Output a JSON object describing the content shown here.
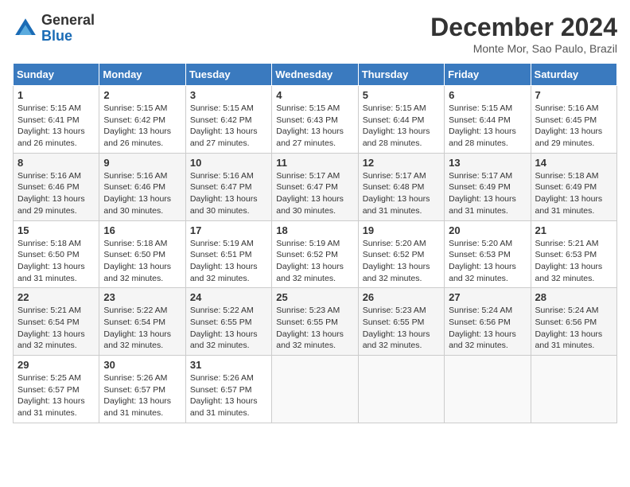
{
  "header": {
    "logo_line1": "General",
    "logo_line2": "Blue",
    "month": "December 2024",
    "location": "Monte Mor, Sao Paulo, Brazil"
  },
  "weekdays": [
    "Sunday",
    "Monday",
    "Tuesday",
    "Wednesday",
    "Thursday",
    "Friday",
    "Saturday"
  ],
  "weeks": [
    [
      {
        "day": "1",
        "rise": "5:15 AM",
        "set": "6:41 PM",
        "daylight": "13 hours and 26 minutes."
      },
      {
        "day": "2",
        "rise": "5:15 AM",
        "set": "6:42 PM",
        "daylight": "13 hours and 26 minutes."
      },
      {
        "day": "3",
        "rise": "5:15 AM",
        "set": "6:42 PM",
        "daylight": "13 hours and 27 minutes."
      },
      {
        "day": "4",
        "rise": "5:15 AM",
        "set": "6:43 PM",
        "daylight": "13 hours and 27 minutes."
      },
      {
        "day": "5",
        "rise": "5:15 AM",
        "set": "6:44 PM",
        "daylight": "13 hours and 28 minutes."
      },
      {
        "day": "6",
        "rise": "5:15 AM",
        "set": "6:44 PM",
        "daylight": "13 hours and 28 minutes."
      },
      {
        "day": "7",
        "rise": "5:16 AM",
        "set": "6:45 PM",
        "daylight": "13 hours and 29 minutes."
      }
    ],
    [
      {
        "day": "8",
        "rise": "5:16 AM",
        "set": "6:46 PM",
        "daylight": "13 hours and 29 minutes."
      },
      {
        "day": "9",
        "rise": "5:16 AM",
        "set": "6:46 PM",
        "daylight": "13 hours and 30 minutes."
      },
      {
        "day": "10",
        "rise": "5:16 AM",
        "set": "6:47 PM",
        "daylight": "13 hours and 30 minutes."
      },
      {
        "day": "11",
        "rise": "5:17 AM",
        "set": "6:47 PM",
        "daylight": "13 hours and 30 minutes."
      },
      {
        "day": "12",
        "rise": "5:17 AM",
        "set": "6:48 PM",
        "daylight": "13 hours and 31 minutes."
      },
      {
        "day": "13",
        "rise": "5:17 AM",
        "set": "6:49 PM",
        "daylight": "13 hours and 31 minutes."
      },
      {
        "day": "14",
        "rise": "5:18 AM",
        "set": "6:49 PM",
        "daylight": "13 hours and 31 minutes."
      }
    ],
    [
      {
        "day": "15",
        "rise": "5:18 AM",
        "set": "6:50 PM",
        "daylight": "13 hours and 31 minutes."
      },
      {
        "day": "16",
        "rise": "5:18 AM",
        "set": "6:50 PM",
        "daylight": "13 hours and 32 minutes."
      },
      {
        "day": "17",
        "rise": "5:19 AM",
        "set": "6:51 PM",
        "daylight": "13 hours and 32 minutes."
      },
      {
        "day": "18",
        "rise": "5:19 AM",
        "set": "6:52 PM",
        "daylight": "13 hours and 32 minutes."
      },
      {
        "day": "19",
        "rise": "5:20 AM",
        "set": "6:52 PM",
        "daylight": "13 hours and 32 minutes."
      },
      {
        "day": "20",
        "rise": "5:20 AM",
        "set": "6:53 PM",
        "daylight": "13 hours and 32 minutes."
      },
      {
        "day": "21",
        "rise": "5:21 AM",
        "set": "6:53 PM",
        "daylight": "13 hours and 32 minutes."
      }
    ],
    [
      {
        "day": "22",
        "rise": "5:21 AM",
        "set": "6:54 PM",
        "daylight": "13 hours and 32 minutes."
      },
      {
        "day": "23",
        "rise": "5:22 AM",
        "set": "6:54 PM",
        "daylight": "13 hours and 32 minutes."
      },
      {
        "day": "24",
        "rise": "5:22 AM",
        "set": "6:55 PM",
        "daylight": "13 hours and 32 minutes."
      },
      {
        "day": "25",
        "rise": "5:23 AM",
        "set": "6:55 PM",
        "daylight": "13 hours and 32 minutes."
      },
      {
        "day": "26",
        "rise": "5:23 AM",
        "set": "6:55 PM",
        "daylight": "13 hours and 32 minutes."
      },
      {
        "day": "27",
        "rise": "5:24 AM",
        "set": "6:56 PM",
        "daylight": "13 hours and 32 minutes."
      },
      {
        "day": "28",
        "rise": "5:24 AM",
        "set": "6:56 PM",
        "daylight": "13 hours and 31 minutes."
      }
    ],
    [
      {
        "day": "29",
        "rise": "5:25 AM",
        "set": "6:57 PM",
        "daylight": "13 hours and 31 minutes."
      },
      {
        "day": "30",
        "rise": "5:26 AM",
        "set": "6:57 PM",
        "daylight": "13 hours and 31 minutes."
      },
      {
        "day": "31",
        "rise": "5:26 AM",
        "set": "6:57 PM",
        "daylight": "13 hours and 31 minutes."
      },
      null,
      null,
      null,
      null
    ]
  ]
}
